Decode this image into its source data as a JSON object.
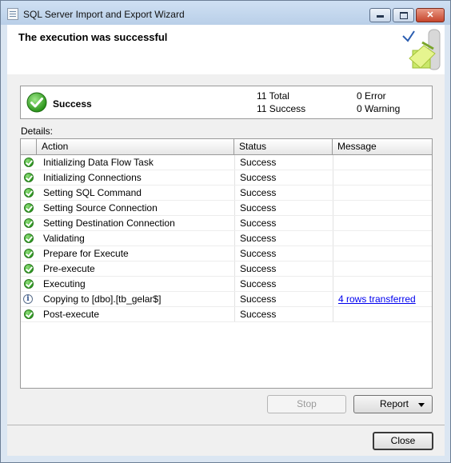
{
  "window": {
    "title": "SQL Server Import and Export Wizard",
    "page_title": "The execution was successful"
  },
  "summary": {
    "status": "Success",
    "total": "11 Total",
    "success": "11 Success",
    "error": "0 Error",
    "warning": "0 Warning"
  },
  "details_label": "Details:",
  "columns": {
    "action": "Action",
    "status": "Status",
    "message": "Message"
  },
  "rows": [
    {
      "icon": "success-icon",
      "action": "Initializing Data Flow Task",
      "status": "Success",
      "message": ""
    },
    {
      "icon": "success-icon",
      "action": "Initializing Connections",
      "status": "Success",
      "message": ""
    },
    {
      "icon": "success-icon",
      "action": "Setting SQL Command",
      "status": "Success",
      "message": ""
    },
    {
      "icon": "success-icon",
      "action": "Setting Source Connection",
      "status": "Success",
      "message": ""
    },
    {
      "icon": "success-icon",
      "action": "Setting Destination Connection",
      "status": "Success",
      "message": ""
    },
    {
      "icon": "success-icon",
      "action": "Validating",
      "status": "Success",
      "message": ""
    },
    {
      "icon": "success-icon",
      "action": "Prepare for Execute",
      "status": "Success",
      "message": ""
    },
    {
      "icon": "success-icon",
      "action": "Pre-execute",
      "status": "Success",
      "message": ""
    },
    {
      "icon": "success-icon",
      "action": "Executing",
      "status": "Success",
      "message": ""
    },
    {
      "icon": "info-icon",
      "action": "Copying to [dbo].[tb_gelar$]",
      "status": "Success",
      "message": "4 rows transferred"
    },
    {
      "icon": "success-icon",
      "action": "Post-execute",
      "status": "Success",
      "message": ""
    }
  ],
  "buttons": {
    "stop": "Stop",
    "report": "Report",
    "close": "Close"
  }
}
